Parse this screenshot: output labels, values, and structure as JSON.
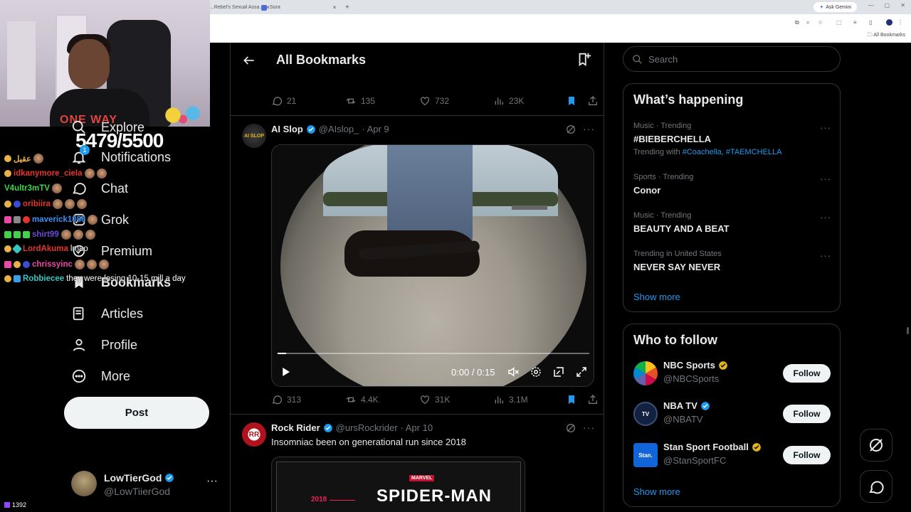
{
  "browser": {
    "tabs": [
      {
        "label": "...Rebel's Sexual Assa..."
      },
      {
        "label": "Sora"
      }
    ],
    "gemini_label": "Ask Gemini",
    "bookmarks_label": "All Bookmarks"
  },
  "stream": {
    "goal_counter": "5479/5500",
    "shirt_text": "ONE WAY",
    "viewer_count": "1392",
    "chat": [
      {
        "user": "عقيل",
        "color": "#e8b14a",
        "message": ""
      },
      {
        "user": "idkanymore_ciela",
        "color": "#e8332a",
        "message": ""
      },
      {
        "user": "V4ultr3mTV",
        "color": "#3fd24a",
        "message": ""
      },
      {
        "user": "oribiira",
        "color": "#e8332a",
        "message": ""
      },
      {
        "user": "maverick1086",
        "color": "#3a8ff0",
        "message": ""
      },
      {
        "user": "shirt99",
        "color": "#6a4bd6",
        "message": ""
      },
      {
        "user": "LordAkuma",
        "color": "#e8332a",
        "message": "lmao"
      },
      {
        "user": "chrissyinc",
        "color": "#ea4aa5",
        "message": ""
      },
      {
        "user": "Robbiecee",
        "color": "#37c6c2",
        "message": "they were losing 10-15 mill a day"
      }
    ]
  },
  "nav": {
    "items": [
      {
        "label": "Explore",
        "icon": "search-icon"
      },
      {
        "label": "Notifications",
        "icon": "bell-icon",
        "badge": "1"
      },
      {
        "label": "Chat",
        "icon": "chat-icon"
      },
      {
        "label": "Grok",
        "icon": "grok-icon"
      },
      {
        "label": "Premium",
        "icon": "premium-icon"
      },
      {
        "label": "Bookmarks",
        "icon": "bookmark-icon"
      },
      {
        "label": "Articles",
        "icon": "articles-icon"
      },
      {
        "label": "Profile",
        "icon": "profile-icon"
      },
      {
        "label": "More",
        "icon": "more-icon"
      }
    ],
    "post_label": "Post",
    "account": {
      "name": "LowTierGod",
      "handle": "@LowTiierGod"
    }
  },
  "main": {
    "title": "All Bookmarks",
    "prev_tweet_stats": {
      "replies": "21",
      "reposts": "135",
      "likes": "732",
      "views": "23K"
    },
    "tweets": [
      {
        "name": "AI Slop",
        "handle": "@AIslop_",
        "date": "· Apr 9",
        "video": {
          "time": "0:00 / 0:15",
          "progress": 0.0
        },
        "stats": {
          "replies": "313",
          "reposts": "4.4K",
          "likes": "31K",
          "views": "3.1M"
        }
      },
      {
        "name": "Rock Rider",
        "handle": "@ursRockrider",
        "date": "· Apr 10",
        "text": "Insomniac been on generational run since 2018",
        "media": {
          "marvel": "MARVEL",
          "title": "SPIDER-MAN",
          "year": "2018"
        }
      }
    ]
  },
  "sidebar": {
    "search_placeholder": "Search",
    "trends_title": "What’s happening",
    "trends": [
      {
        "meta": "Music · Trending",
        "name": "#BIEBERCHELLA",
        "sub_prefix": "Trending with ",
        "sub_links": "#Coachella, #TAEMCHELLA"
      },
      {
        "meta": "Sports · Trending",
        "name": "Conor"
      },
      {
        "meta": "Music · Trending",
        "name": "BEAUTY AND A BEAT"
      },
      {
        "meta": "Trending in United States",
        "name": "NEVER SAY NEVER"
      }
    ],
    "show_more": "Show more",
    "follow_title": "Who to follow",
    "follow": [
      {
        "name": "NBC Sports",
        "handle": "@NBCSports",
        "button": "Follow",
        "badge_color": "#e2b719"
      },
      {
        "name": "NBA TV",
        "handle": "@NBATV",
        "button": "Follow",
        "badge_color": "#1d9bf0"
      },
      {
        "name": "Stan Sport Football",
        "handle": "@StanSportFC",
        "button": "Follow",
        "badge_color": "#e2b719"
      }
    ],
    "follow_show_more": "Show more"
  },
  "colors": {
    "accent": "#1d9bf0",
    "bookmark_active": "#1d9bf0",
    "gold_badge": "#e2b719"
  }
}
